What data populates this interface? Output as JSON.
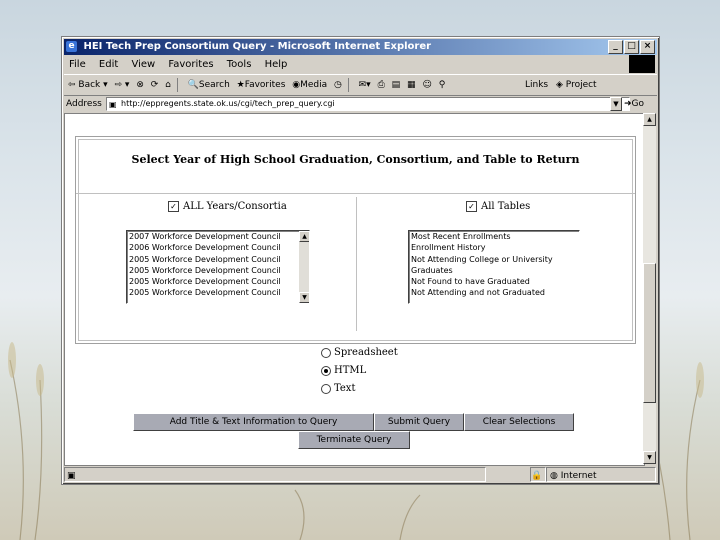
{
  "window": {
    "title": "HEI Tech Prep Consortium Query - Microsoft Internet Explorer",
    "menu": [
      "File",
      "Edit",
      "View",
      "Favorites",
      "Tools",
      "Help"
    ]
  },
  "toolbar": {
    "back": "Back",
    "search": "Search",
    "favorites": "Favorites",
    "media": "Media",
    "links": "Links",
    "project": "Project"
  },
  "address": {
    "label": "Address",
    "url": "http://eppregents.state.ok.us/cgi/tech_prep_query.cgi",
    "go": "Go"
  },
  "form": {
    "heading": "Select Year of High School Graduation, Consortium, and Table to Return",
    "all_years_label": "ALL Years/Consortia",
    "all_tables_label": "All Tables",
    "years_options": [
      "2007 Workforce Development Council",
      "2006 Workforce Development Council",
      "2005 Workforce Development Council",
      "2005 Workforce Development Council",
      "2005 Workforce Development Council",
      "2005 Workforce Development Council"
    ],
    "tables_options": [
      "Most Recent Enrollments",
      "Enrollment History",
      "Not Attending College or University",
      "Graduates",
      "Not Found to have Graduated",
      "Not Attending and not Graduated"
    ],
    "output_options": [
      {
        "label": "Spreadsheet",
        "selected": false
      },
      {
        "label": "HTML",
        "selected": true
      },
      {
        "label": "Text",
        "selected": false
      }
    ],
    "buttons": {
      "add_title": "Add Title & Text Information to Query",
      "submit": "Submit Query",
      "clear": "Clear Selections",
      "terminate": "Terminate Query"
    }
  },
  "status": {
    "zone": "Internet"
  },
  "icons": {
    "page": "ie-page-icon",
    "lock": "lock-icon",
    "globe": "internet-globe-icon"
  }
}
